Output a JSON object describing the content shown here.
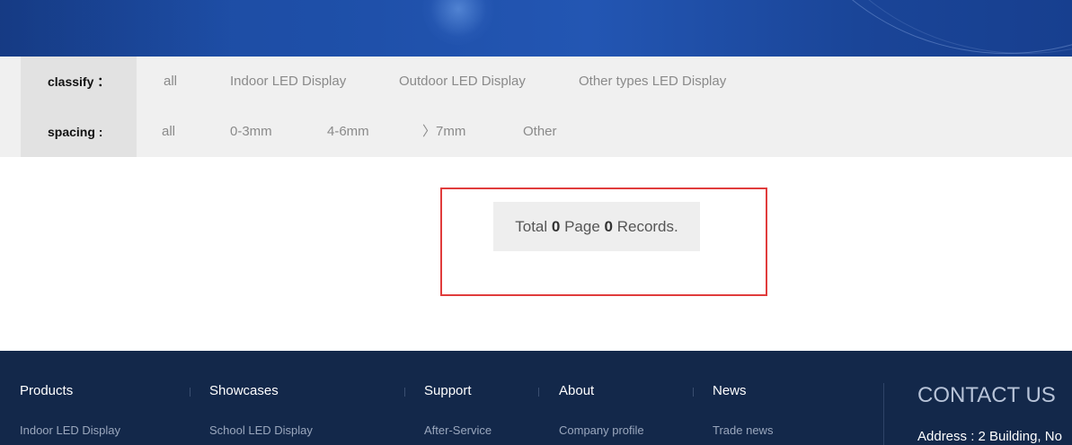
{
  "filters": {
    "classify": {
      "label": "classify ：",
      "options": [
        "all",
        "Indoor LED Display",
        "Outdoor LED Display",
        "Other types LED Display"
      ]
    },
    "spacing": {
      "label": "spacing :",
      "options": [
        "all",
        "0-3mm",
        "4-6mm",
        "〉7mm",
        "Other"
      ]
    }
  },
  "pager": {
    "prefix": "Total ",
    "pages": "0",
    "middle": " Page ",
    "records": "0",
    "suffix": " Records."
  },
  "footer": {
    "columns": [
      {
        "title": "Products",
        "first_link": "Indoor LED Display"
      },
      {
        "title": "Showcases",
        "first_link": "School LED Display"
      },
      {
        "title": "Support",
        "first_link": "After-Service"
      },
      {
        "title": "About",
        "first_link": "Company profile"
      },
      {
        "title": "News",
        "first_link": "Trade news"
      }
    ],
    "contact": {
      "title": "CONTACT US",
      "address": "Address : 2 Building, No"
    }
  },
  "colors": {
    "banner": "#1e4fa8",
    "filter_bg": "#f0f0f0",
    "filter_label_bg": "#e2e2e2",
    "highlight_border": "#e03c3c",
    "footer_bg": "#13284a"
  }
}
